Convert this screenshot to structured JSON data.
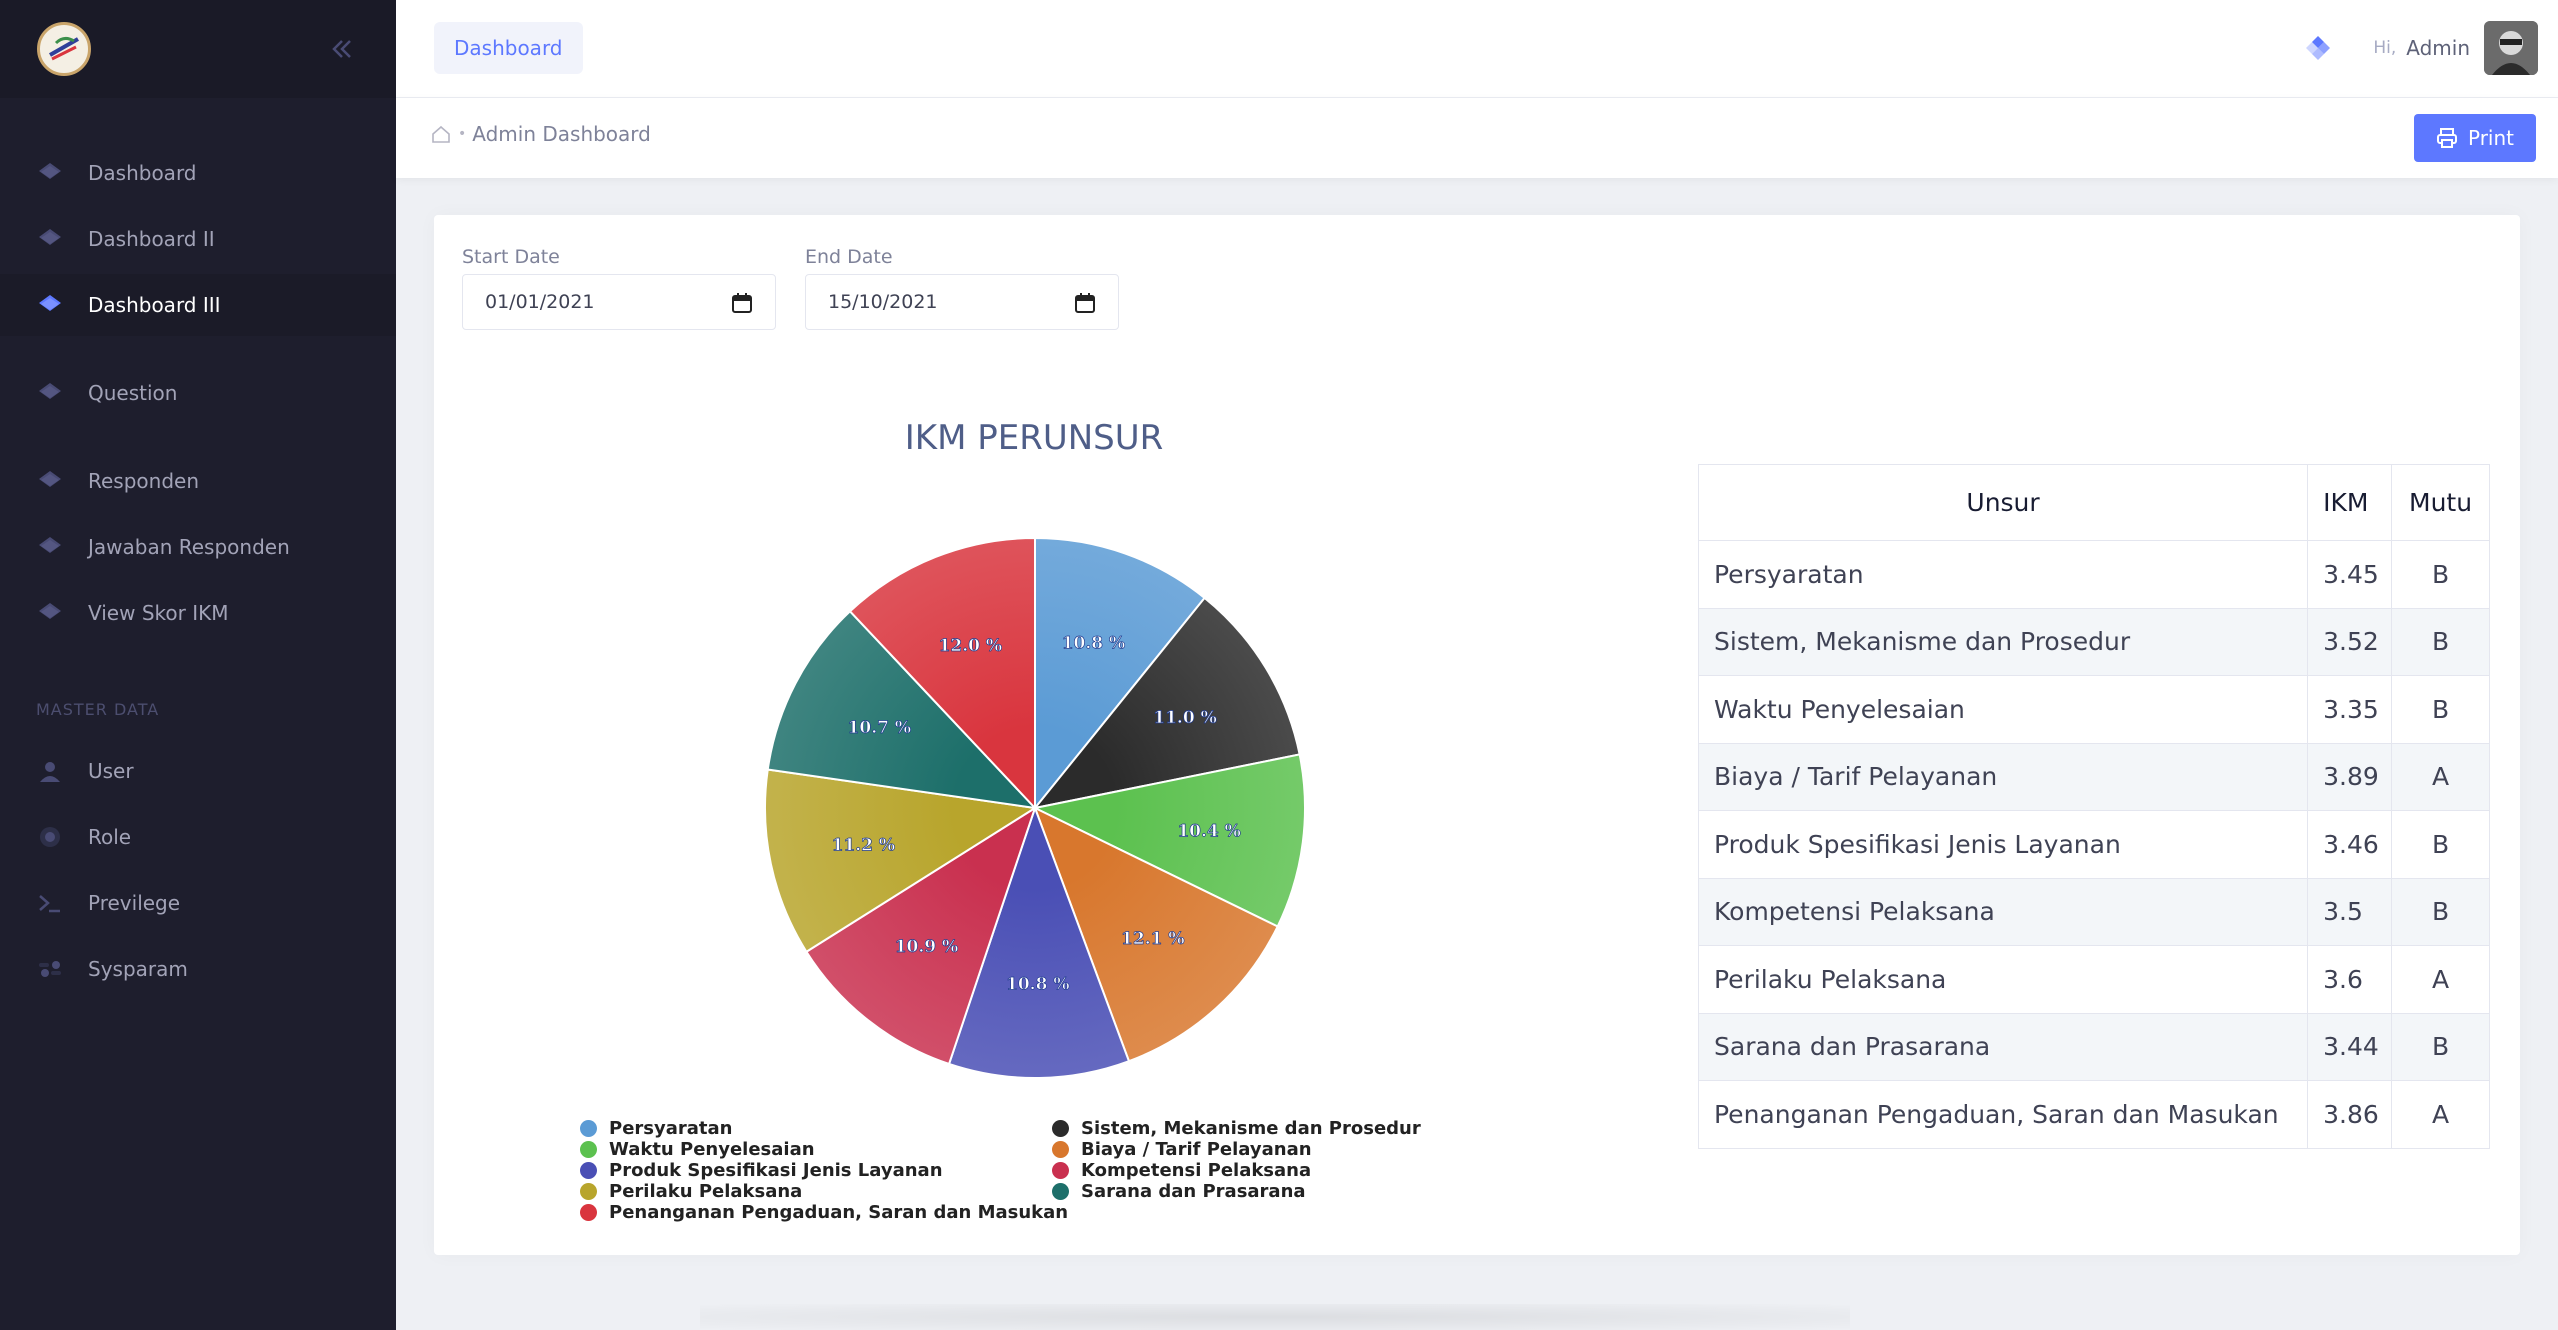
{
  "sidebar": {
    "items": [
      {
        "label": "Dashboard"
      },
      {
        "label": "Dashboard II"
      },
      {
        "label": "Dashboard III"
      },
      {
        "label": "Question"
      },
      {
        "label": "Responden"
      },
      {
        "label": "Jawaban Responden"
      },
      {
        "label": "View Skor IKM"
      }
    ],
    "section_label": "MASTER DATA",
    "master_items": [
      {
        "label": "User"
      },
      {
        "label": "Role"
      },
      {
        "label": "Previlege"
      },
      {
        "label": "Sysparam"
      }
    ]
  },
  "header": {
    "tab_label": "Dashboard",
    "greeting": "Hi,",
    "user_name": "Admin"
  },
  "subheader": {
    "breadcrumb": "Admin Dashboard",
    "print_label": "Print"
  },
  "filters": {
    "start_label": "Start Date",
    "start_value": "01/01/2021",
    "end_label": "End Date",
    "end_value": "15/10/2021"
  },
  "chart_data": {
    "type": "pie",
    "title": "IKM PERUNSUR",
    "categories": [
      "Persyaratan",
      "Sistem, Mekanisme dan Prosedur",
      "Waktu Penyelesaian",
      "Biaya / Tarif Pelayanan",
      "Produk Spesifikasi Jenis Layanan",
      "Kompetensi Pelaksana",
      "Perilaku Pelaksana",
      "Sarana dan Prasarana",
      "Penanganan Pengaduan, Saran dan Masukan"
    ],
    "values": [
      10.8,
      11.0,
      10.4,
      12.1,
      10.8,
      10.9,
      11.2,
      10.7,
      12.0
    ],
    "labels": [
      "10.8 %",
      "11.0 %",
      "10.4 %",
      "12.1 %",
      "10.8 %",
      "10.9 %",
      "11.2 %",
      "10.7 %",
      "12.0 %"
    ],
    "colors": [
      "#5b9bd5",
      "#2b2b2b",
      "#5cc14f",
      "#d8772d",
      "#4a4fb5",
      "#c9304f",
      "#b8a52c",
      "#1d6f6a",
      "#d9353e"
    ],
    "legend": "bottom"
  },
  "table": {
    "headers": [
      "Unsur",
      "IKM",
      "Mutu"
    ],
    "rows": [
      [
        "Persyaratan",
        "3.45",
        "B"
      ],
      [
        "Sistem, Mekanisme dan Prosedur",
        "3.52",
        "B"
      ],
      [
        "Waktu Penyelesaian",
        "3.35",
        "B"
      ],
      [
        "Biaya / Tarif Pelayanan",
        "3.89",
        "A"
      ],
      [
        "Produk Spesifikasi Jenis Layanan",
        "3.46",
        "B"
      ],
      [
        "Kompetensi Pelaksana",
        "3.5",
        "B"
      ],
      [
        "Perilaku Pelaksana",
        "3.6",
        "A"
      ],
      [
        "Sarana dan Prasarana",
        "3.44",
        "B"
      ],
      [
        "Penanganan Pengaduan, Saran dan Masukan",
        "3.86",
        "A"
      ]
    ]
  },
  "colors": {
    "accent": "#5d78ff",
    "sidebar_bg": "#1e1e2d",
    "page_bg": "#eef0f4"
  }
}
